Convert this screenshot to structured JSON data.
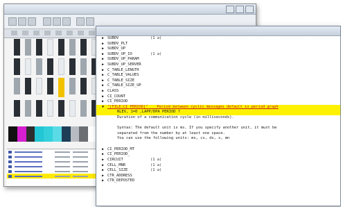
{
  "back_window": {
    "strip_colors": [
      "#111111",
      "#d61fd0",
      "#2d2d2d",
      "#22c6d4",
      "#33d0dc",
      "#5adbe6",
      "#1e3e58",
      "#b8bcc2",
      "#6b6f74",
      "#ffffff"
    ]
  },
  "front_window": {
    "lines": [
      {
        "name": "SUBDV",
        "type": "(1 a)"
      },
      {
        "name": "SUBDV_PLT",
        "type": ""
      },
      {
        "name": "SUBDV_UP",
        "type": ""
      },
      {
        "name": "SUBDV_UP_IO",
        "type": "(1 a)"
      },
      {
        "name": "SUBDV_UP_PARAM",
        "type": ""
      },
      {
        "name": "SUBDV_UP_SERVER",
        "type": ""
      },
      {
        "name": "C_TABLE_LENGTH",
        "type": ""
      },
      {
        "name": "C_TABLE_VALUES",
        "type": ""
      },
      {
        "name": "C_TABLE_SIZE",
        "type": ""
      },
      {
        "name": "C_TABLE_SIZE_UP",
        "type": ""
      },
      {
        "name": "CLASS",
        "type": ""
      },
      {
        "name": "CI_COUNT",
        "type": ""
      },
      {
        "name": "CI_PERIOD",
        "type": ""
      }
    ],
    "highlight_line": "\"[FILE:CI_PERIOD]\"    Period between cyclic messages default is period graph",
    "highlight_sub": "NLEV, 1=0 ,LAPP/DPA PERIOD ?",
    "desc_lines": [
      "Duration of a communication cycle (in milliseconds).",
      "",
      "Syntax: The default unit is ms. If you specify another unit, it must be",
      "separated from the number by at least one space.",
      "You can use the following units: ms, cs, ds, s, mn"
    ],
    "after_lines": [
      {
        "name": "CI_PERIOD_MT",
        "type": ""
      },
      {
        "name": "CI_PERIOD_",
        "type": ""
      },
      {
        "name": "CIRCUIT",
        "type": "(1 a)"
      },
      {
        "name": "CELL_MNR",
        "type": "(1 a)"
      },
      {
        "name": "CELL_SIZE",
        "type": "(1 a)"
      },
      {
        "name": "CTR_ADDRESS",
        "type": ""
      },
      {
        "name": "CTR_DEPOSTED",
        "type": ""
      }
    ]
  }
}
